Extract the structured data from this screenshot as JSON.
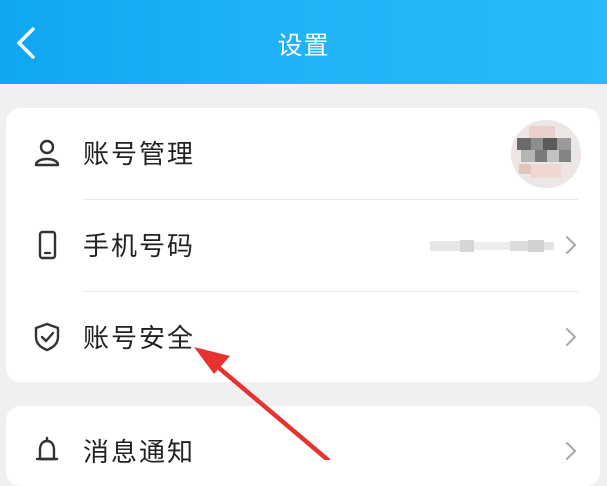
{
  "header": {
    "title": "设置",
    "back_icon": "chevron-left-icon",
    "color": "#1fb2f6"
  },
  "settings_group_1": {
    "items": [
      {
        "label": "账号管理",
        "icon": "user-icon",
        "trailing": "avatar"
      },
      {
        "label": "手机号码",
        "icon": "phone-icon",
        "trailing": "chevron-right-icon"
      },
      {
        "label": "账号安全",
        "icon": "shield-check-icon",
        "trailing": "chevron-right-icon"
      }
    ]
  },
  "settings_group_2": {
    "items": [
      {
        "label": "消息通知",
        "icon": "bell-icon",
        "trailing": "chevron-right-icon"
      }
    ]
  },
  "annotation": {
    "arrow_color": "#e8322f",
    "target": "账号安全"
  }
}
